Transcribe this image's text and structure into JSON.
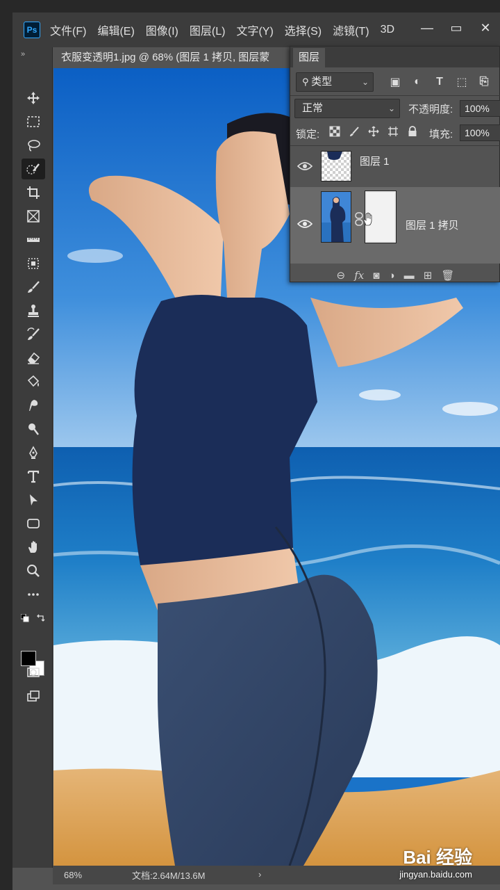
{
  "app": {
    "logo": "Ps"
  },
  "menu": [
    "文件(F)",
    "编辑(E)",
    "图像(I)",
    "图层(L)",
    "文字(Y)",
    "选择(S)",
    "滤镜(T)",
    "3D"
  ],
  "window_controls": {
    "minimize": "—",
    "restore": "▭",
    "close": "✕"
  },
  "toolbar": {
    "collapse": "»",
    "tools": [
      "move-icon",
      "marquee-icon",
      "lasso-icon",
      "quick-selection-icon",
      "crop-icon",
      "frame-icon",
      "ruler-icon",
      "patch-icon",
      "brush-icon",
      "stamp-icon",
      "history-brush-icon",
      "eraser-icon",
      "paint-bucket-icon",
      "smudge-icon",
      "dodge-icon",
      "pen-icon",
      "type-icon",
      "path-selection-icon",
      "rectangle-icon",
      "hand-icon",
      "zoom-icon",
      "more-icon"
    ],
    "active_tool": "quick-selection-icon",
    "foreground_color": "#000000",
    "background_color": "#ffffff"
  },
  "document": {
    "tab_title": "衣服变透明1.jpg @ 68% (图层 1 拷贝, 图层蒙"
  },
  "status": {
    "zoom": "68%",
    "doc_size": "文档:2.64M/13.6M",
    "arrow": "›"
  },
  "watermark": {
    "brand": "Bai  经验",
    "url": "jingyan.baidu.com"
  },
  "layers_panel": {
    "tab": "图层",
    "filter_kind": "类型",
    "filter_icons": [
      "image-filter-icon",
      "adjustment-filter-icon",
      "type-filter-icon",
      "shape-filter-icon",
      "smart-object-filter-icon"
    ],
    "filter_glyphs": [
      "▣",
      "◐",
      "T",
      "⬚",
      "⎘"
    ],
    "blend_mode": "正常",
    "opacity_label": "不透明度:",
    "opacity_value": "100%",
    "lock_label": "锁定:",
    "fill_label": "填充:",
    "fill_value": "100%",
    "layers": [
      {
        "name": "图层 1",
        "visible": true,
        "selected": false,
        "has_mask": false
      },
      {
        "name": "图层 1 拷贝",
        "visible": true,
        "selected": true,
        "has_mask": true
      }
    ],
    "footer_icons": [
      "link-icon",
      "fx-icon",
      "mask-icon",
      "adjustment-icon",
      "folder-icon",
      "new-layer-icon",
      "trash-icon"
    ],
    "footer_glyphs": [
      "⊖",
      "fx",
      "◙",
      "◑",
      "▬",
      "⊞",
      "🗑"
    ]
  },
  "colors": {
    "ui_dark": "#3c3c3c",
    "ui_mid": "#535353",
    "selected_row": "#6a6a6a"
  }
}
